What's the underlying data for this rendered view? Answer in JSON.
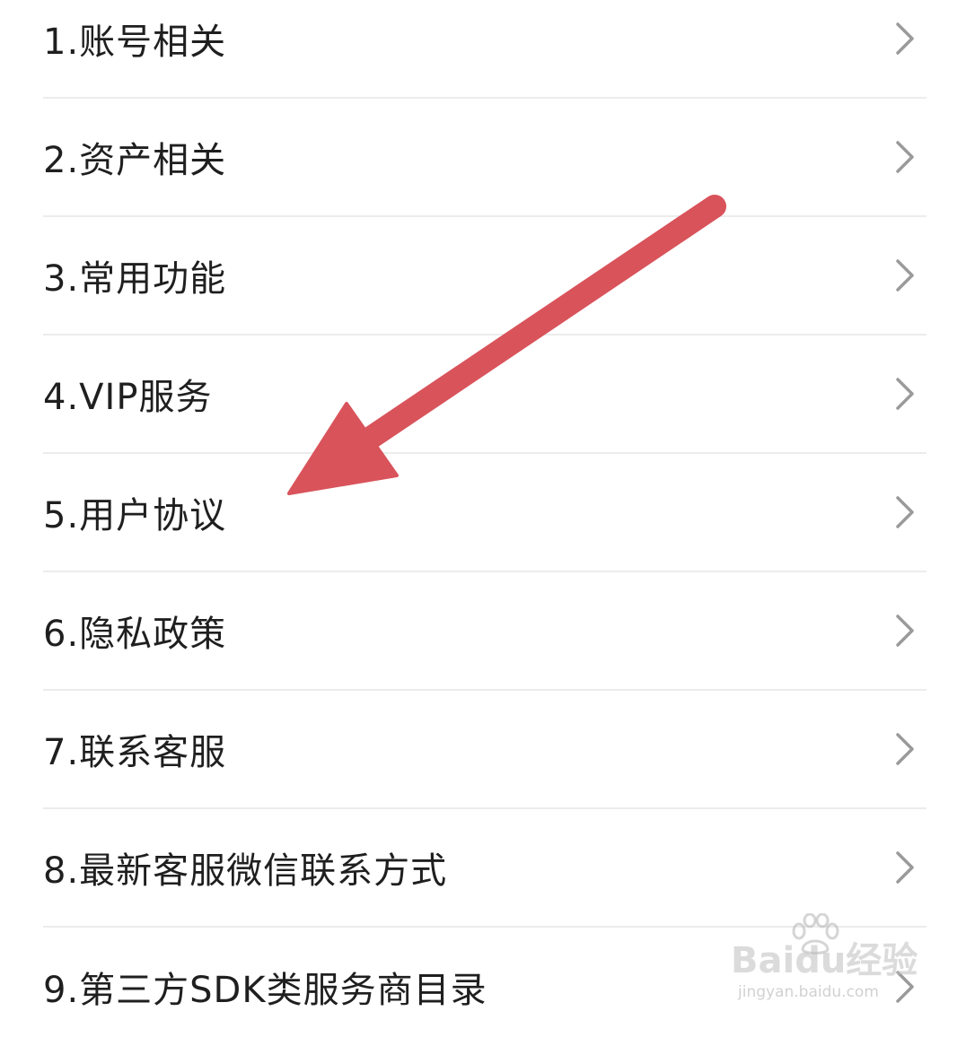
{
  "menu": {
    "items": [
      {
        "label": "1.账号相关"
      },
      {
        "label": "2.资产相关"
      },
      {
        "label": "3.常用功能"
      },
      {
        "label": "4.VIP服务"
      },
      {
        "label": "5.用户协议"
      },
      {
        "label": "6.隐私政策"
      },
      {
        "label": "7.联系客服"
      },
      {
        "label": "8.最新客服微信联系方式"
      },
      {
        "label": "9.第三方SDK类服务商目录"
      }
    ],
    "chevron_icon": "chevron-right-icon"
  },
  "annotation": {
    "arrow_color": "#d9535b"
  },
  "colors": {
    "text": "#1f1f1f",
    "divider": "#ececec",
    "chevron": "#9a9a9a"
  },
  "watermark": {
    "logo_text": "Baidu经验",
    "url_text": "jingyan.baidu.com"
  }
}
